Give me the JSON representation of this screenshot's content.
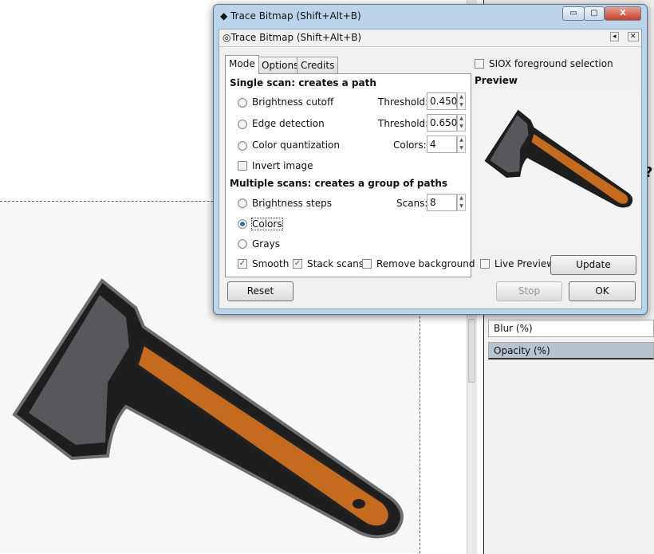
{
  "window": {
    "title": "Trace Bitmap (Shift+Alt+B)",
    "minimize": "▭",
    "maximize": "▢",
    "close": "X"
  },
  "dialog": {
    "title": "Trace Bitmap (Shift+Alt+B)",
    "collapse": "◂",
    "close": "✕"
  },
  "tabs": [
    {
      "label": "Mode",
      "active": true
    },
    {
      "label": "Options"
    },
    {
      "label": "Credits"
    }
  ],
  "single_scan": {
    "heading": "Single scan: creates a path",
    "options": [
      {
        "label": "Brightness cutoff",
        "field": "Threshold:",
        "value": "0.450",
        "selected": false
      },
      {
        "label": "Edge detection",
        "field": "Threshold:",
        "value": "0.650",
        "selected": false
      },
      {
        "label": "Color quantization",
        "field": "Colors:",
        "value": "4",
        "selected": false
      }
    ],
    "invert": {
      "label": "Invert image",
      "checked": false
    }
  },
  "multi_scan": {
    "heading": "Multiple scans: creates a group of paths",
    "options": [
      {
        "label": "Brightness steps",
        "field": "Scans:",
        "value": "8",
        "selected": false
      },
      {
        "label": "Colors",
        "selected": true
      },
      {
        "label": "Grays",
        "selected": false
      }
    ],
    "smooth": {
      "label": "Smooth",
      "checked": true
    },
    "stack": {
      "label": "Stack scans",
      "checked": true
    },
    "remove_bg": {
      "label": "Remove background",
      "checked": false
    }
  },
  "siox": {
    "label": "SIOX foreground selection",
    "checked": false
  },
  "preview": {
    "heading": "Preview",
    "live_label": "Live Preview",
    "live_checked": false,
    "update": "Update"
  },
  "buttons": {
    "reset": "Reset",
    "stop": "Stop",
    "ok": "OK"
  },
  "right_panel": {
    "blur": "Blur (%)",
    "opacity": "Opacity (%)",
    "partial": "?"
  },
  "colors": {
    "axe_head": "#58585c",
    "axe_handle": "#c46b20",
    "outline": "#1e1e1e",
    "selected_row": "#b7c4cf"
  }
}
